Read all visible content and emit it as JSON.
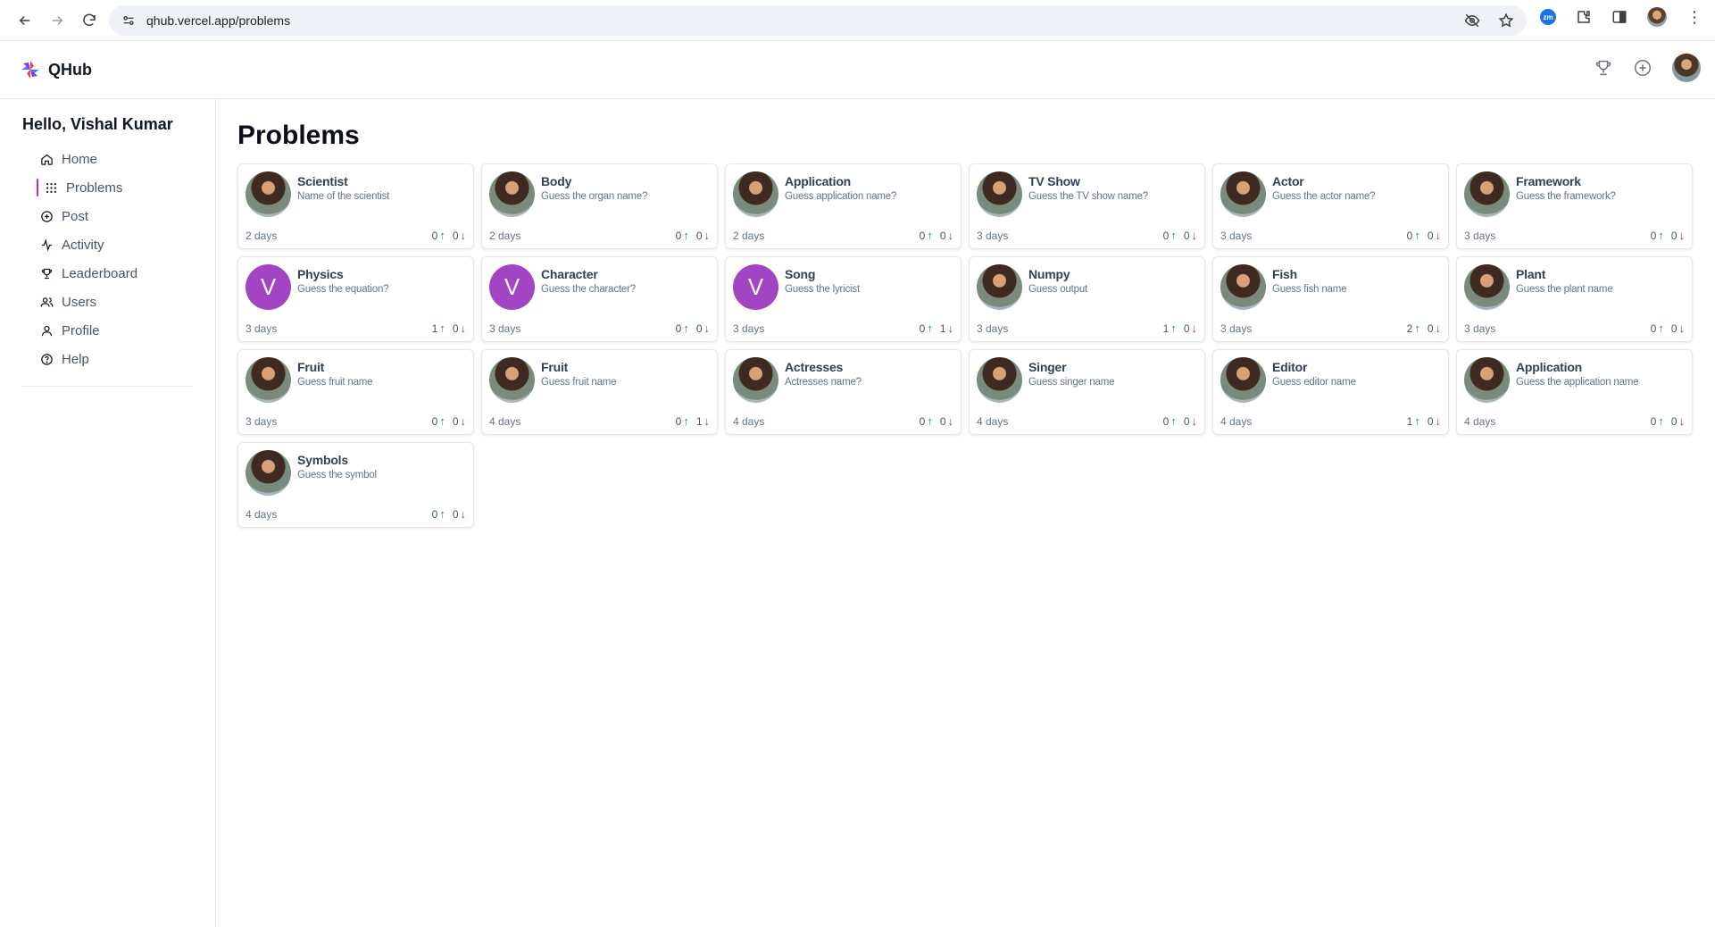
{
  "browser": {
    "url": "qhub.vercel.app/problems",
    "extension_label": "zm"
  },
  "app": {
    "name": "QHub"
  },
  "sidebar": {
    "greeting": "Hello, Vishal Kumar",
    "items": [
      {
        "label": "Home",
        "icon": "home-icon"
      },
      {
        "label": "Problems",
        "icon": "grid-icon"
      },
      {
        "label": "Post",
        "icon": "plus-circle-icon"
      },
      {
        "label": "Activity",
        "icon": "activity-icon"
      },
      {
        "label": "Leaderboard",
        "icon": "trophy-icon"
      },
      {
        "label": "Users",
        "icon": "users-icon"
      },
      {
        "label": "Profile",
        "icon": "user-icon"
      },
      {
        "label": "Help",
        "icon": "help-circle-icon"
      }
    ],
    "active": "Problems"
  },
  "main": {
    "title": "Problems",
    "cards": [
      {
        "title": "Scientist",
        "subtitle": "Name of the scientist",
        "age": "2 days",
        "up": "0",
        "down": "0",
        "avatar": "photo"
      },
      {
        "title": "Body",
        "subtitle": "Guess the organ name?",
        "age": "2 days",
        "up": "0",
        "down": "0",
        "avatar": "photo"
      },
      {
        "title": "Application",
        "subtitle": "Guess application name?",
        "age": "2 days",
        "up": "0",
        "down": "0",
        "avatar": "photo"
      },
      {
        "title": "TV Show",
        "subtitle": "Guess the TV show name?",
        "age": "3 days",
        "up": "0",
        "down": "0",
        "avatar": "photo"
      },
      {
        "title": "Actor",
        "subtitle": "Guess the actor name?",
        "age": "3 days",
        "up": "0",
        "down": "0",
        "avatar": "photo"
      },
      {
        "title": "Framework",
        "subtitle": "Guess the framework?",
        "age": "3 days",
        "up": "0",
        "down": "0",
        "avatar": "photo"
      },
      {
        "title": "Physics",
        "subtitle": "Guess the equation?",
        "age": "3 days",
        "up": "1",
        "down": "0",
        "avatar": "V"
      },
      {
        "title": "Character",
        "subtitle": "Guess the character?",
        "age": "3 days",
        "up": "0",
        "down": "0",
        "avatar": "V"
      },
      {
        "title": "Song",
        "subtitle": "Guess the lyricist",
        "age": "3 days",
        "up": "0",
        "down": "1",
        "avatar": "V"
      },
      {
        "title": "Numpy",
        "subtitle": "Guess output",
        "age": "3 days",
        "up": "1",
        "down": "0",
        "avatar": "photo"
      },
      {
        "title": "Fish",
        "subtitle": "Guess fish name",
        "age": "3 days",
        "up": "2",
        "down": "0",
        "avatar": "photo"
      },
      {
        "title": "Plant",
        "subtitle": "Guess the plant name",
        "age": "3 days",
        "up": "0",
        "down": "0",
        "avatar": "photo"
      },
      {
        "title": "Fruit",
        "subtitle": "Guess fruit name",
        "age": "3 days",
        "up": "0",
        "down": "0",
        "avatar": "photo"
      },
      {
        "title": "Fruit",
        "subtitle": "Guess fruit name",
        "age": "4 days",
        "up": "0",
        "down": "1",
        "avatar": "photo"
      },
      {
        "title": "Actresses",
        "subtitle": "Actresses name?",
        "age": "4 days",
        "up": "0",
        "down": "0",
        "avatar": "photo"
      },
      {
        "title": "Singer",
        "subtitle": "Guess singer name",
        "age": "4 days",
        "up": "0",
        "down": "0",
        "avatar": "photo"
      },
      {
        "title": "Editor",
        "subtitle": "Guess editor name",
        "age": "4 days",
        "up": "1",
        "down": "0",
        "avatar": "photo"
      },
      {
        "title": "Application",
        "subtitle": "Guess the application name",
        "age": "4 days",
        "up": "0",
        "down": "0",
        "avatar": "photo"
      },
      {
        "title": "Symbols",
        "subtitle": "Guess the symbol",
        "age": "4 days",
        "up": "0",
        "down": "0",
        "avatar": "photo"
      }
    ]
  },
  "colors": {
    "up_arrow": "#16a34a",
    "down_arrow": "#dc2626",
    "letter_avatar": "#a244c4",
    "active_indicator": "#c026d3"
  }
}
